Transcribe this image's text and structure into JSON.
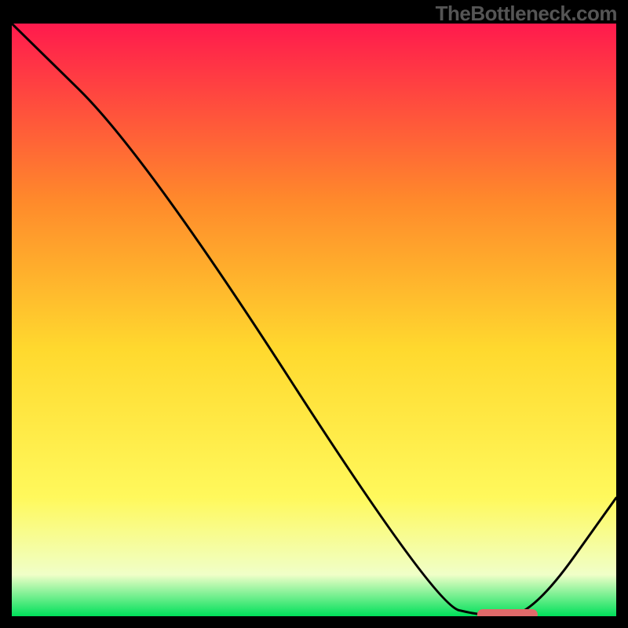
{
  "watermark": "TheBottleneck.com",
  "colors": {
    "gradient_top": "#ff1a4d",
    "gradient_mid_upper": "#ff8a2b",
    "gradient_mid": "#ffd92e",
    "gradient_mid_lower": "#fff95c",
    "gradient_pale": "#f0ffc8",
    "gradient_bottom": "#00e05a",
    "curve": "#000000",
    "marker": "#e06a6a",
    "frame": "#000000"
  },
  "chart_data": {
    "type": "line",
    "title": "",
    "xlabel": "",
    "ylabel": "",
    "x": [
      0,
      22,
      70,
      78,
      86,
      100
    ],
    "values": [
      100,
      78,
      2,
      0,
      0,
      20
    ],
    "ylim": [
      0,
      100
    ],
    "xlim": [
      0,
      100
    ],
    "marker_segment": {
      "x_start": 77,
      "x_end": 87,
      "y": 0
    },
    "notes": "Vertical gradient background from red (top) through orange/yellow to green at bottom. Single black curve descending from top-left, reaching a flat minimum near x≈77–86, then rising toward the right edge. A short rounded salmon-colored marker sits on the flat minimum."
  }
}
